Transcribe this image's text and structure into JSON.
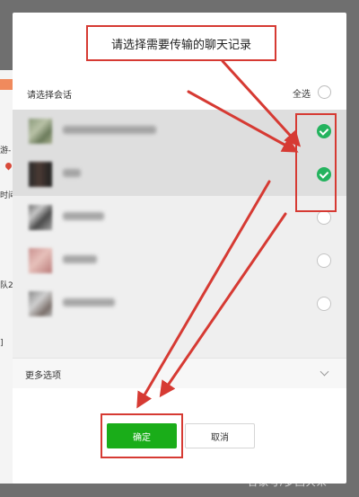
{
  "background_app": {
    "fragments": [
      "游-",
      "时间",
      "队2",
      "]"
    ]
  },
  "dialog": {
    "title": "请选择需要传输的聊天记录",
    "list_header": {
      "label": "请选择会话",
      "select_all_label": "全选",
      "select_all_checked": false
    },
    "conversations": [
      {
        "name_obscured": true,
        "selected": true,
        "avatar_color": "#8a9a7a"
      },
      {
        "name_obscured": true,
        "selected": true,
        "avatar_color": "#2a2a2a"
      },
      {
        "name_obscured": true,
        "selected": false,
        "avatar_color": "#6f6f6f"
      },
      {
        "name_obscured": true,
        "selected": false,
        "avatar_color": "#c9908e"
      },
      {
        "name_obscured": true,
        "selected": false,
        "avatar_color": "#8a8a8a"
      }
    ],
    "more_options_label": "更多选项",
    "confirm_label": "确定",
    "cancel_label": "取消"
  },
  "colors": {
    "accent_green": "#1aad19",
    "check_green": "#24b35e",
    "annotation_red": "#d63a33"
  },
  "icons": [
    "check-icon",
    "chevron-down-icon",
    "location-pin-icon"
  ],
  "watermark": "百家号/梦回大宋"
}
